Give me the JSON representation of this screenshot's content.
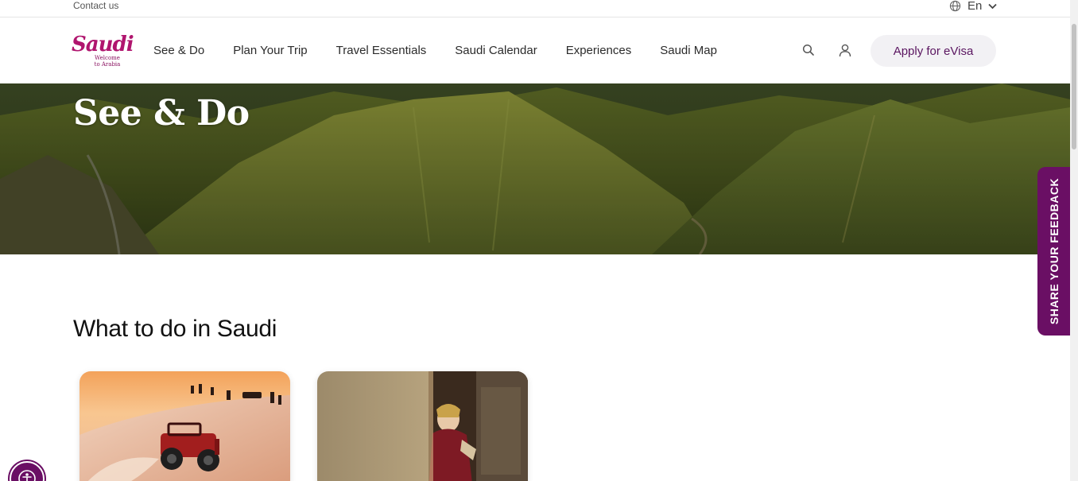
{
  "utility": {
    "contact_label": "Contact us",
    "language_label": "En"
  },
  "nav": {
    "logo": {
      "word": "Saudi",
      "tagline_line1": "Welcome",
      "tagline_line2": "to Arabia"
    },
    "links": [
      {
        "label": "See & Do"
      },
      {
        "label": "Plan Your Trip"
      },
      {
        "label": "Travel Essentials"
      },
      {
        "label": "Saudi Calendar"
      },
      {
        "label": "Experiences"
      },
      {
        "label": "Saudi Map"
      }
    ],
    "search_icon": "search-icon",
    "user_icon": "user-icon",
    "cta_label": "Apply for eVisa"
  },
  "hero": {
    "title": "See & Do"
  },
  "section": {
    "title": "What to do in Saudi"
  },
  "feedback": {
    "label": "SHARE YOUR FEEDBACK"
  },
  "colors": {
    "brand": "#6a0f64",
    "logo": "#b0156e",
    "cta_bg": "#f2f1f4",
    "cta_text": "#5a1560"
  }
}
